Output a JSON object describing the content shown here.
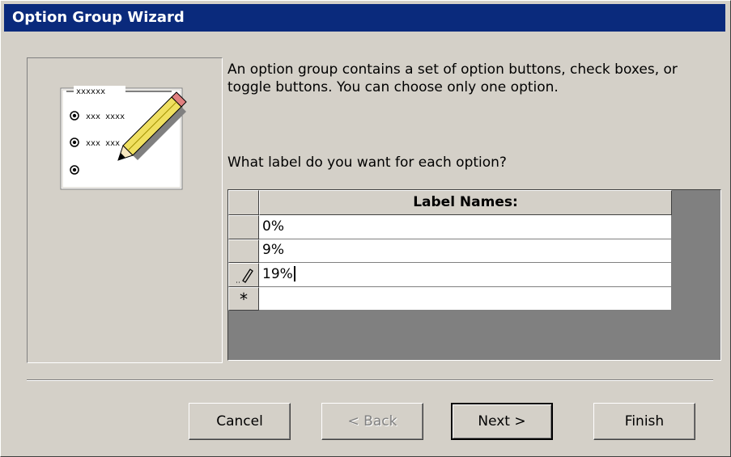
{
  "window": {
    "title": "Option Group Wizard"
  },
  "illustration": {
    "group_caption": "xxxxxx",
    "options": [
      "xxx xxxx",
      "xxx xxx",
      ""
    ]
  },
  "description": "An option group contains a set of option buttons, check boxes, or toggle buttons. You can choose only one option.",
  "question": "What label do you want for each option?",
  "grid": {
    "header": "Label Names:",
    "rows": [
      {
        "selector": "",
        "value": "0%"
      },
      {
        "selector": "",
        "value": "9%"
      },
      {
        "selector": "pencil",
        "value": "19%"
      },
      {
        "selector": "*",
        "value": ""
      }
    ]
  },
  "buttons": {
    "cancel": "Cancel",
    "back": "< Back",
    "next": "Next >",
    "finish": "Finish"
  }
}
